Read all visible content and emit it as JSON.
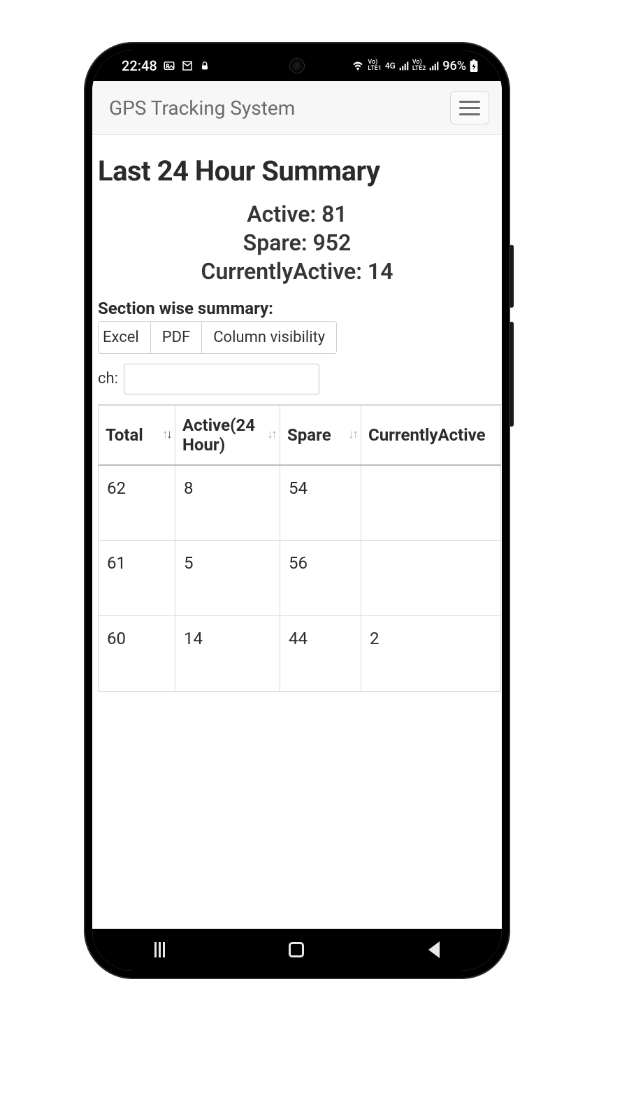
{
  "statusbar": {
    "time": "22:48",
    "battery": "96%"
  },
  "header": {
    "title": "GPS Tracking System"
  },
  "page": {
    "title": "Last 24 Hour Summary"
  },
  "stats": {
    "active_label": "Active:",
    "active_value": "81",
    "spare_label": "Spare:",
    "spare_value": "952",
    "current_label": "CurrentlyActive:",
    "current_value": "14"
  },
  "section_label": "Section wise summary:",
  "toolbar": {
    "excel": "Excel",
    "pdf": "PDF",
    "colvis": "Column visibility"
  },
  "search": {
    "label": "ch:",
    "value": ""
  },
  "table": {
    "headers": {
      "total": "Total",
      "active24": "Active(24 Hour)",
      "spare": "Spare",
      "current": "CurrentlyActive"
    },
    "rows": [
      {
        "total": "62",
        "active24": "8",
        "spare": "54",
        "current": ""
      },
      {
        "total": "61",
        "active24": "5",
        "spare": "56",
        "current": ""
      },
      {
        "total": "60",
        "active24": "14",
        "spare": "44",
        "current": "2"
      }
    ]
  }
}
